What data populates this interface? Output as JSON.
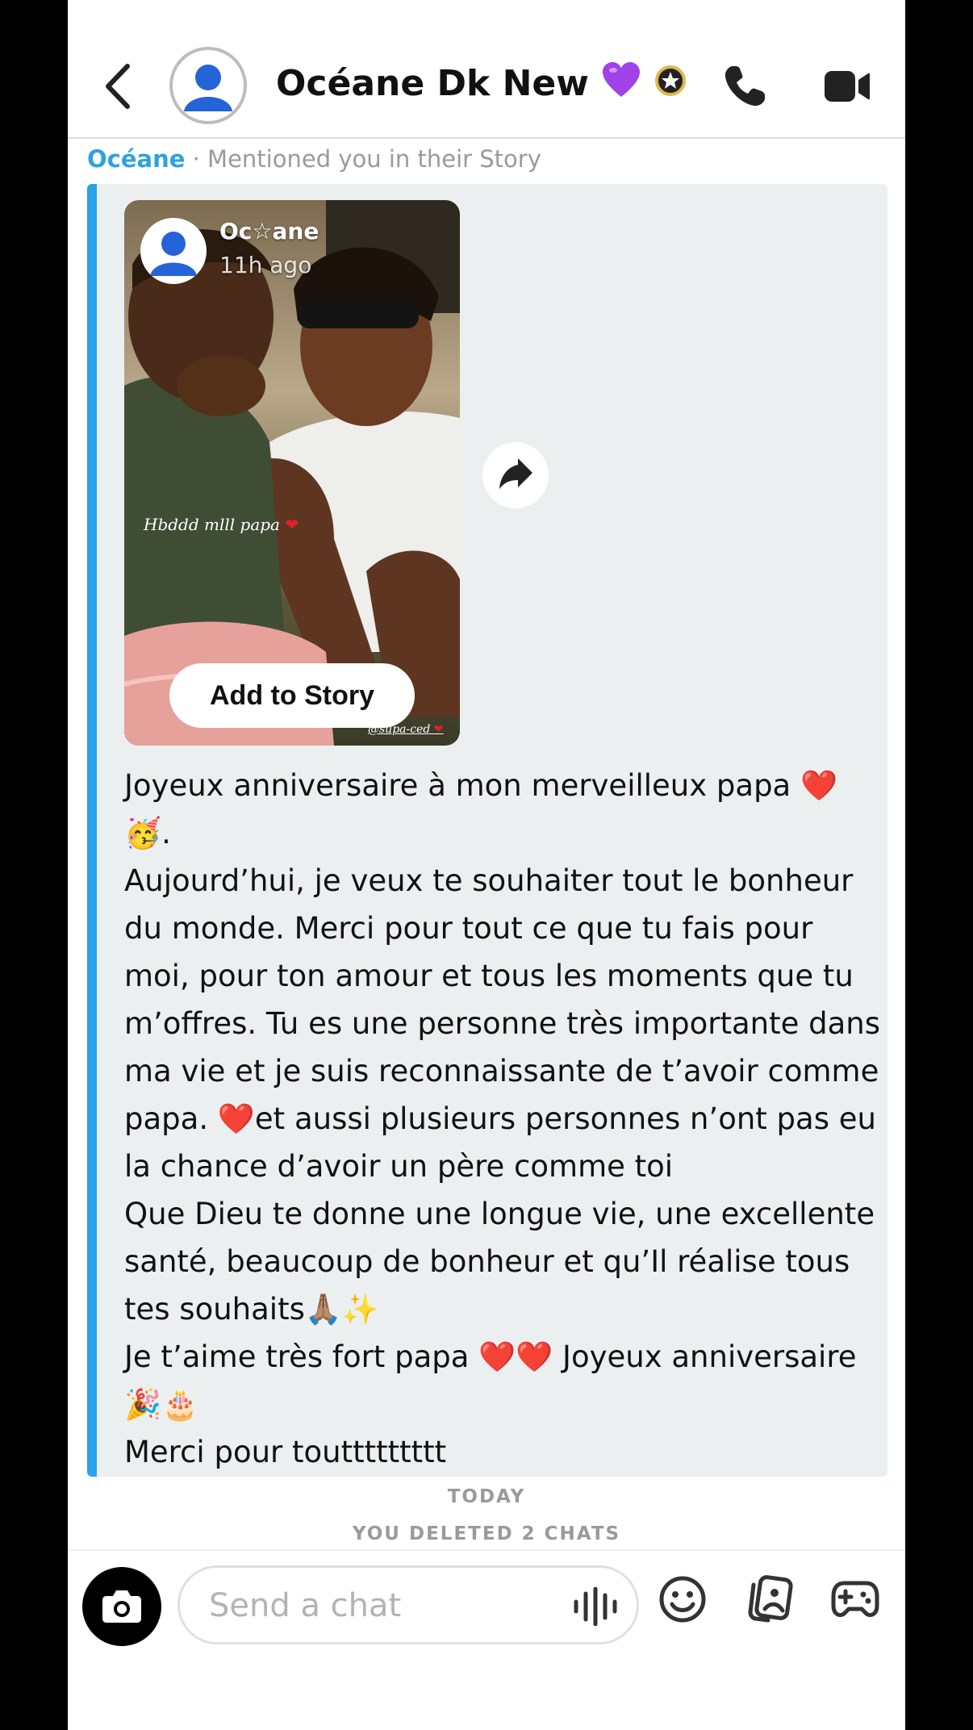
{
  "header": {
    "contact_name": "Océane Dk New",
    "name_emoji": "purple-heart",
    "badge_icon": "star-badge-icon"
  },
  "mention": {
    "name": "Océane",
    "text": "· Mentioned you in their Story"
  },
  "story": {
    "author": "Oc☆ane",
    "time": "11h ago",
    "caption": "Hbddd mlll papa",
    "handle": "@supa-ced",
    "add_to_story_label": "Add to Story"
  },
  "message": {
    "lines": [
      "Joyeux anniversaire à mon merveilleux papa ❤️",
      "🥳.",
      "Aujourd’hui, je veux te souhaiter tout le bonheur",
      "du monde. Merci pour tout ce que tu fais pour",
      "moi, pour ton amour et tous les moments que tu",
      "m’offres. Tu es une personne très importante dans",
      "ma vie et je suis reconnaissante de t’avoir comme",
      "papa. ❤️et aussi plusieurs personnes n’ont pas eu",
      "la chance d’avoir un père comme toi",
      "Que Dieu te donne une longue vie, une excellente",
      "santé, beaucoup de bonheur et qu’Il réalise tous",
      "tes souhaits🙏🏽✨",
      "Je t’aime très fort papa ❤️❤️ Joyeux anniversaire",
      "🎉🎂",
      "Merci pour touttttttttt"
    ]
  },
  "separators": {
    "today": "TODAY",
    "deleted": "YOU DELETED 2 CHATS"
  },
  "composer": {
    "placeholder": "Send a chat"
  },
  "colors": {
    "accent_blue": "#27a3e6",
    "mention_blue": "#2fa2de",
    "bubble_bg": "#eceff0"
  }
}
